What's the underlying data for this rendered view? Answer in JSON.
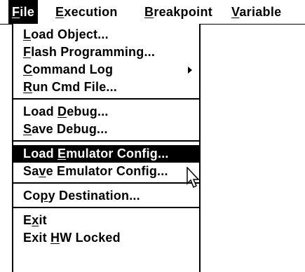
{
  "menubar": {
    "items": [
      {
        "label": "File",
        "mnemonic": "F",
        "active": true
      },
      {
        "label": "Execution",
        "mnemonic": "E",
        "active": false
      },
      {
        "label": "Breakpoint",
        "mnemonic": "B",
        "active": false
      },
      {
        "label": "Variable",
        "mnemonic": "V",
        "active": false
      }
    ]
  },
  "file_menu": {
    "groups": [
      [
        {
          "label": "Load Object...",
          "mnemonic_index": 0,
          "submenu": false,
          "highlighted": false
        },
        {
          "label": "Flash Programming...",
          "mnemonic_index": 0,
          "submenu": false,
          "highlighted": false
        },
        {
          "label": "Command Log",
          "mnemonic_index": 0,
          "submenu": true,
          "highlighted": false
        },
        {
          "label": "Run Cmd File...",
          "mnemonic_index": 0,
          "submenu": false,
          "highlighted": false
        }
      ],
      [
        {
          "label": "Load Debug...",
          "mnemonic_index": 5,
          "submenu": false,
          "highlighted": false
        },
        {
          "label": "Save Debug...",
          "mnemonic_index": 0,
          "submenu": false,
          "highlighted": false
        }
      ],
      [
        {
          "label": "Load Emulator Config...",
          "mnemonic_index": 5,
          "submenu": false,
          "highlighted": true
        },
        {
          "label": "Save Emulator Config...",
          "mnemonic_index": 2,
          "submenu": false,
          "highlighted": false
        }
      ],
      [
        {
          "label": "Copy Destination...",
          "mnemonic_index": 2,
          "submenu": false,
          "highlighted": false
        }
      ],
      [
        {
          "label": "Exit",
          "mnemonic_index": 1,
          "submenu": false,
          "highlighted": false
        },
        {
          "label": "Exit HW Locked",
          "mnemonic_index": 5,
          "submenu": false,
          "highlighted": false
        }
      ]
    ]
  },
  "colors": {
    "background": "#ffffff",
    "foreground": "#000000",
    "highlight_bg": "#000000",
    "highlight_fg": "#ffffff"
  },
  "icons": {
    "submenu": "chevron-right-icon",
    "cursor": "mouse-pointer-icon"
  }
}
